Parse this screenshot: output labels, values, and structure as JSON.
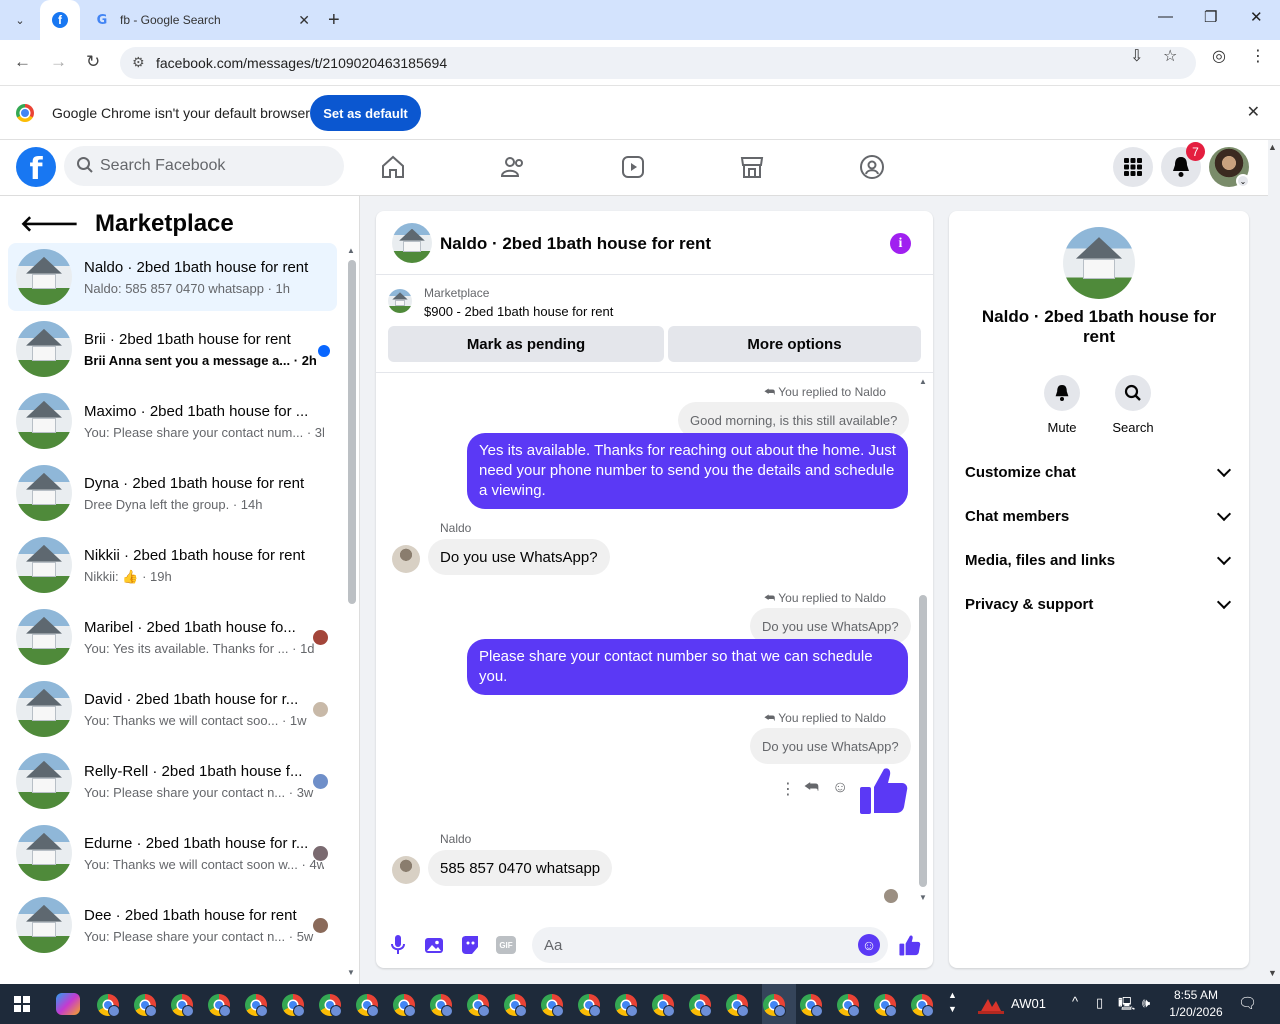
{
  "browser": {
    "tabs": [
      {
        "title": "",
        "icon": "facebook-icon"
      },
      {
        "title": "fb - Google Search",
        "icon": "google-icon"
      }
    ],
    "url": "facebook.com/messages/t/2109020463185694",
    "infobar_text": "Google Chrome isn't your default browser",
    "infobar_button": "Set as default"
  },
  "fb": {
    "search_placeholder": "Search Facebook",
    "notification_count": "7"
  },
  "sidebar": {
    "title": "Marketplace",
    "conversations": [
      {
        "name": "Naldo · 2bed 1bath house for rent",
        "snippet": "Naldo: 585 857 0470 whatsapp · 1h",
        "selected": true
      },
      {
        "name": "Brii · 2bed 1bath house for rent",
        "snippet": "Brii Anna sent you a message a... · 2h",
        "unread": true
      },
      {
        "name": "Maximo · 2bed 1bath house for ...",
        "snippet": "You: Please share your contact num... · 3h"
      },
      {
        "name": "Dyna · 2bed 1bath house for rent",
        "snippet": "Dree Dyna left the group. · 14h"
      },
      {
        "name": "Nikkii · 2bed 1bath house for rent",
        "snippet": "Nikkii: 👍 · 19h"
      },
      {
        "name": "Maribel · 2bed 1bath house fo...",
        "snippet": "You: Yes its available. Thanks for ... · 1d"
      },
      {
        "name": "David · 2bed 1bath house for r...",
        "snippet": "You: Thanks we will contact soo... · 1w"
      },
      {
        "name": "Relly-Rell · 2bed 1bath house f...",
        "snippet": "You: Please share your contact n... · 3w"
      },
      {
        "name": "Edurne · 2bed 1bath house for r...",
        "snippet": "You: Thanks we will contact soon w... · 4w"
      },
      {
        "name": "Dee · 2bed 1bath house for rent",
        "snippet": "You: Please share your contact n... · 5w"
      }
    ]
  },
  "chat": {
    "title": "Naldo · 2bed 1bath house for rent",
    "listing_source": "Marketplace",
    "listing_title": "$900 - 2bed 1bath house for rent",
    "btn_pending": "Mark as pending",
    "btn_more": "More options",
    "replied_label": "You replied to Naldo",
    "quote1": "Good morning, is this still available?",
    "out1": "Yes its available. Thanks for reaching out about the home. Just need your phone number to send you the details and schedule a viewing.",
    "sender": "Naldo",
    "in1": "Do you use WhatsApp?",
    "quote2": "Do you use WhatsApp?",
    "out2": "Please share your contact number so that we can schedule you.",
    "quote3": "Do you use WhatsApp?",
    "in2": "585 857 0470  whatsapp",
    "composer_placeholder": "Aa"
  },
  "infopanel": {
    "title": "Naldo · 2bed 1bath house for rent",
    "mute": "Mute",
    "search": "Search",
    "rows": [
      "Customize chat",
      "Chat members",
      "Media, files and links",
      "Privacy & support"
    ]
  },
  "taskbar": {
    "app_label": "AW01",
    "time": "8:55 AM",
    "date": "1/20/2026"
  },
  "colors": {
    "fb_blue": "#1877f2",
    "messenger_purple": "#5b39f5",
    "chrome_blue": "#0b57d0"
  }
}
